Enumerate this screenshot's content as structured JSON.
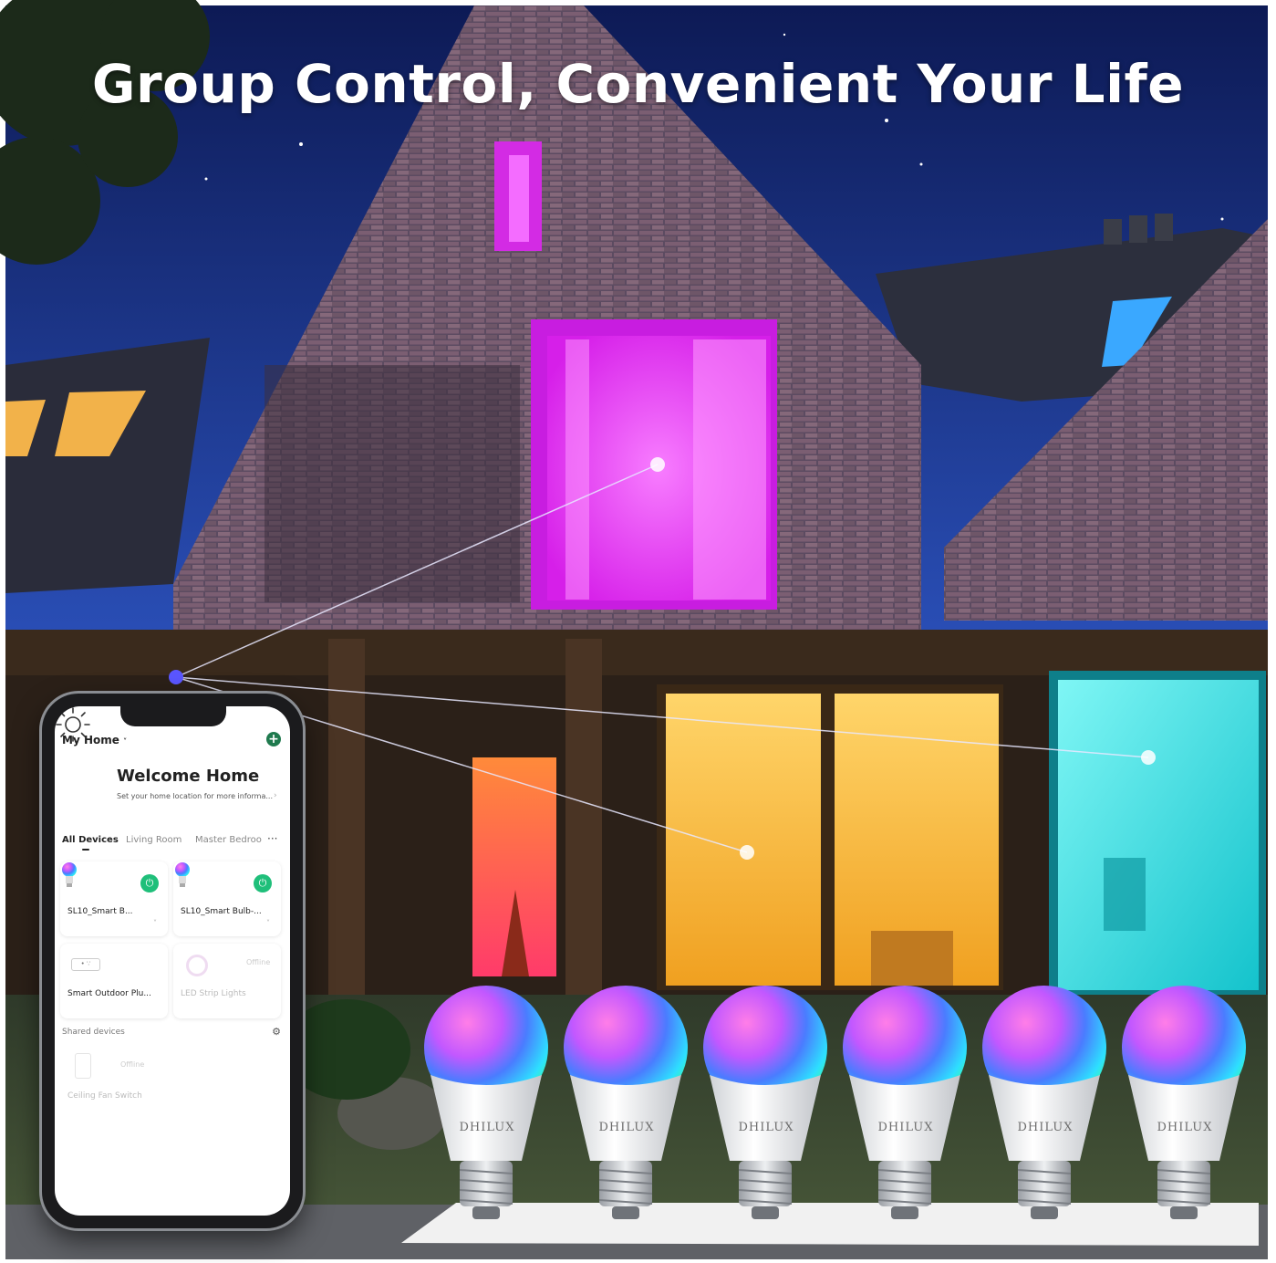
{
  "headline": "Group Control, Convenient Your Life",
  "colors": {
    "sky_top": "#0c1750",
    "sky_bottom": "#3a63cf",
    "brick": "#5a4a5f",
    "window_magenta": "#e72ef6",
    "window_orange": "#ff6a2a",
    "window_yellow": "#ffc540",
    "window_cyan": "#29e2e4",
    "app_accent": "#1fbf7a"
  },
  "app": {
    "home_label": "My Home",
    "add_icon": "plus-circle-icon",
    "welcome_title": "Welcome Home",
    "welcome_subtitle": "Set your home location for more informa...",
    "tabs": [
      {
        "label": "All Devices",
        "active": true
      },
      {
        "label": "Living Room",
        "active": false
      },
      {
        "label": "Master Bedroo",
        "active": false
      }
    ],
    "more_icon": "···",
    "devices": [
      {
        "name": "SL10_Smart B...",
        "status": "on",
        "icon": "bulb-icon"
      },
      {
        "name": "SL10_Smart Bulb-...",
        "status": "on",
        "icon": "bulb-icon"
      },
      {
        "name": "Smart Outdoor Plu...",
        "status": "online",
        "icon": "plug-icon"
      },
      {
        "name": "LED Strip Lights",
        "status": "Offline",
        "icon": "strip-light-icon"
      }
    ],
    "shared_label": "Shared devices",
    "shared_devices": [
      {
        "name": "Ceiling Fan Switch",
        "status": "Offline",
        "icon": "switch-icon"
      }
    ]
  },
  "bulbs": {
    "brand": "DHILUX",
    "count": 6
  }
}
